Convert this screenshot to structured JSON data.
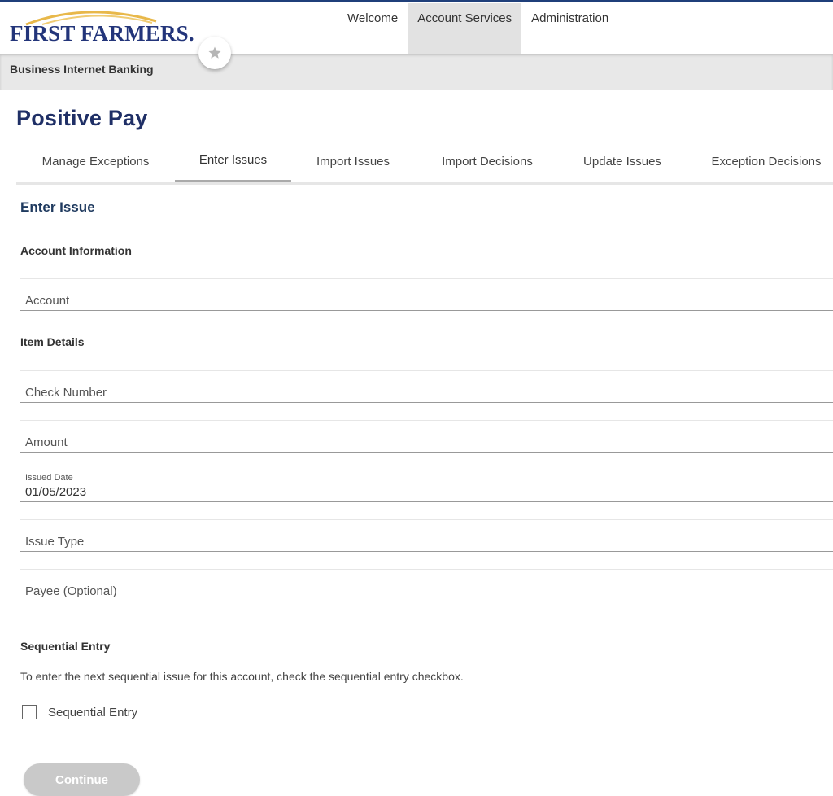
{
  "header": {
    "brand": "FIRST FARMERS.",
    "nav": [
      {
        "label": "Welcome",
        "active": false
      },
      {
        "label": "Account Services",
        "active": true
      },
      {
        "label": "Administration",
        "active": false
      }
    ],
    "subtitle": "Business Internet Banking"
  },
  "page": {
    "title": "Positive Pay",
    "tabs": [
      {
        "label": "Manage Exceptions",
        "active": false
      },
      {
        "label": "Enter Issues",
        "active": true
      },
      {
        "label": "Import Issues",
        "active": false
      },
      {
        "label": "Import Decisions",
        "active": false
      },
      {
        "label": "Update Issues",
        "active": false
      },
      {
        "label": "Exception Decisions",
        "active": false
      }
    ]
  },
  "form": {
    "title": "Enter Issue",
    "account_section": "Account Information",
    "account_placeholder": "Account",
    "item_section": "Item Details",
    "check_number_placeholder": "Check Number",
    "amount_placeholder": "Amount",
    "issued_date_label": "Issued Date",
    "issued_date_value": "01/05/2023",
    "issue_type_placeholder": "Issue Type",
    "payee_placeholder": "Payee (Optional)",
    "sequential_section": "Sequential Entry",
    "sequential_description": "To enter the next sequential issue for this account, check the sequential entry checkbox.",
    "sequential_checkbox_label": "Sequential Entry",
    "sequential_checked": false,
    "continue_label": "Continue"
  },
  "colors": {
    "brand_navy": "#23357a",
    "logo_arc": "#e8b84a",
    "title_navy": "#1f2f66",
    "disabled_button": "#c9c9c9"
  },
  "icons": {
    "favorite": "star-icon",
    "logo": "arc-logo-icon"
  }
}
